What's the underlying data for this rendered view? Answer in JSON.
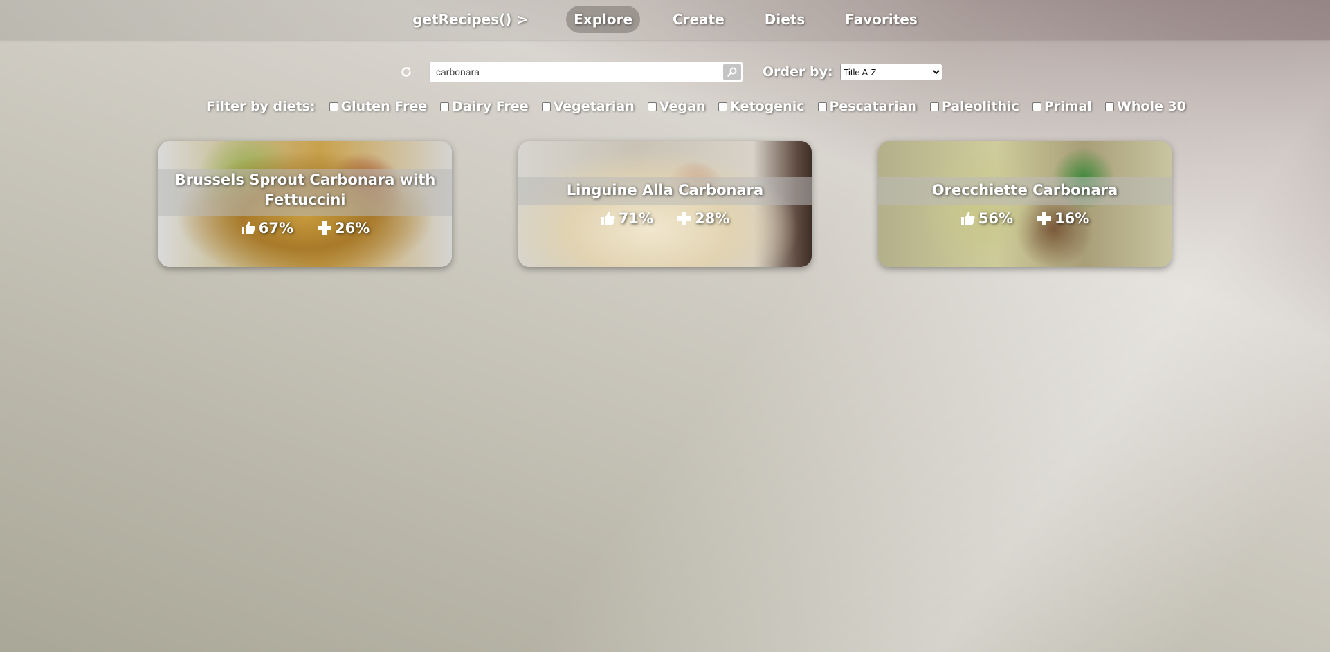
{
  "nav": {
    "brand": "getRecipes() >",
    "items": [
      {
        "label": "Explore",
        "active": true
      },
      {
        "label": "Create",
        "active": false
      },
      {
        "label": "Diets",
        "active": false
      },
      {
        "label": "Favorites",
        "active": false
      }
    ]
  },
  "search": {
    "value": "carbonara",
    "refresh_icon": "refresh-icon",
    "search_icon": "search-icon"
  },
  "order": {
    "label": "Order by:",
    "selected": "Title A-Z"
  },
  "filters": {
    "label": "Filter by diets:",
    "diets": [
      {
        "label": "Gluten Free",
        "checked": false
      },
      {
        "label": "Dairy Free",
        "checked": false
      },
      {
        "label": "Vegetarian",
        "checked": false
      },
      {
        "label": "Vegan",
        "checked": false
      },
      {
        "label": "Ketogenic",
        "checked": false
      },
      {
        "label": "Pescatarian",
        "checked": false
      },
      {
        "label": "Paleolithic",
        "checked": false
      },
      {
        "label": "Primal",
        "checked": false
      },
      {
        "label": "Whole 30",
        "checked": false
      }
    ]
  },
  "recipes": [
    {
      "title": "Brussels Sprout Carbonara with Fettuccini",
      "likes": "67%",
      "health": "26%"
    },
    {
      "title": "Linguine Alla Carbonara",
      "likes": "71%",
      "health": "28%"
    },
    {
      "title": "Orecchiette Carbonara",
      "likes": "56%",
      "health": "16%"
    }
  ],
  "icons": {
    "likes": "thumbs-up-icon",
    "health": "plus-icon"
  }
}
